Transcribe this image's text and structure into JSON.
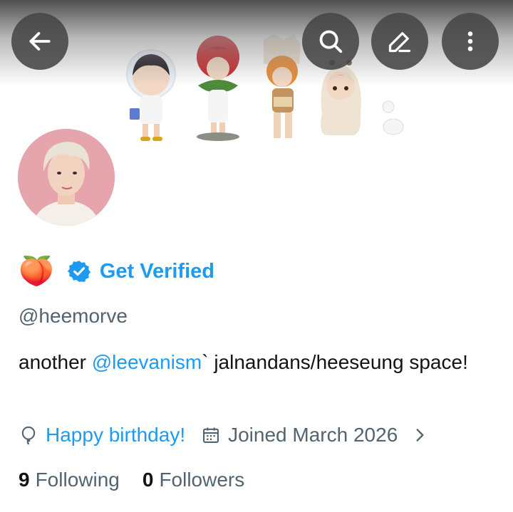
{
  "header": {
    "back_icon": "arrow-left-icon",
    "search_icon": "search-icon",
    "edit_icon": "pencil-icon",
    "more_icon": "more-vertical-icon"
  },
  "profile": {
    "display_emoji": "🍑",
    "verified_label": "Get Verified",
    "handle": "@heemorve",
    "bio": {
      "prefix": "another ",
      "mention": "@leevanism",
      "suffix": "` jalnandans/heeseung space!"
    },
    "birthday": "Happy birthday!",
    "joined": "Joined March 2026",
    "following_count": "9",
    "following_label": "Following",
    "followers_count": "0",
    "followers_label": "Followers"
  },
  "colors": {
    "accent": "#1d9bf0",
    "secondary_text": "#536471",
    "primary_text": "#0f1419"
  }
}
